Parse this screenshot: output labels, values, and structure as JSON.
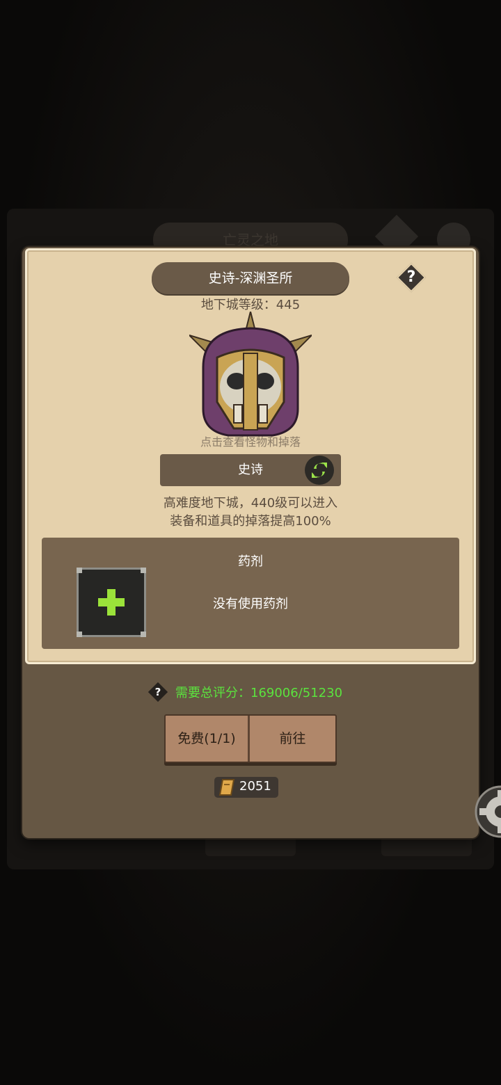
{
  "background": {
    "title": "亡灵之地"
  },
  "dialog": {
    "title": "史诗-深渊圣所",
    "help_icon": "question-icon",
    "level_label": "地下城等级：445",
    "boss_icon": "skull-helmet-icon",
    "tap_hint": "点击查看怪物和掉落",
    "difficulty": "史诗",
    "swap_icon": "refresh-icon",
    "description_line1": "高难度地下城，440级可以进入",
    "description_line2": "装备和道具的掉落提高100%",
    "potion": {
      "title": "药剂",
      "status": "没有使用药剂",
      "add_icon": "plus-icon"
    },
    "score": {
      "text": "需要总评分：169006/51230",
      "color": "#5be33e"
    },
    "buttons": {
      "free": "免费(1/1)",
      "go": "前往"
    },
    "ticket": {
      "icon": "ticket-scroll-icon",
      "count": "2051"
    }
  },
  "side": {
    "settings_icon": "gear-icon"
  }
}
